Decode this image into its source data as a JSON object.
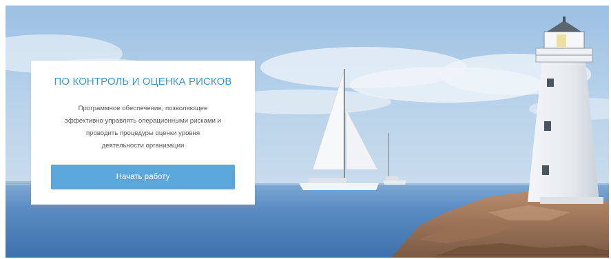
{
  "hero": {
    "title": "ПО КОНТРОЛЬ И ОЦЕНКА РИСКОВ",
    "description_lines": [
      "Программное обеспечение, позволяющее",
      "эффективно управлять операционными рисками и",
      "проводить процедуры оценки уровня",
      "деятельности организации"
    ],
    "cta_label": "Начать работу"
  },
  "colors": {
    "accent": "#3f97cf",
    "button": "#5aa7dc",
    "sky_top": "#9fc3e4",
    "sea": "#4f83bd"
  }
}
